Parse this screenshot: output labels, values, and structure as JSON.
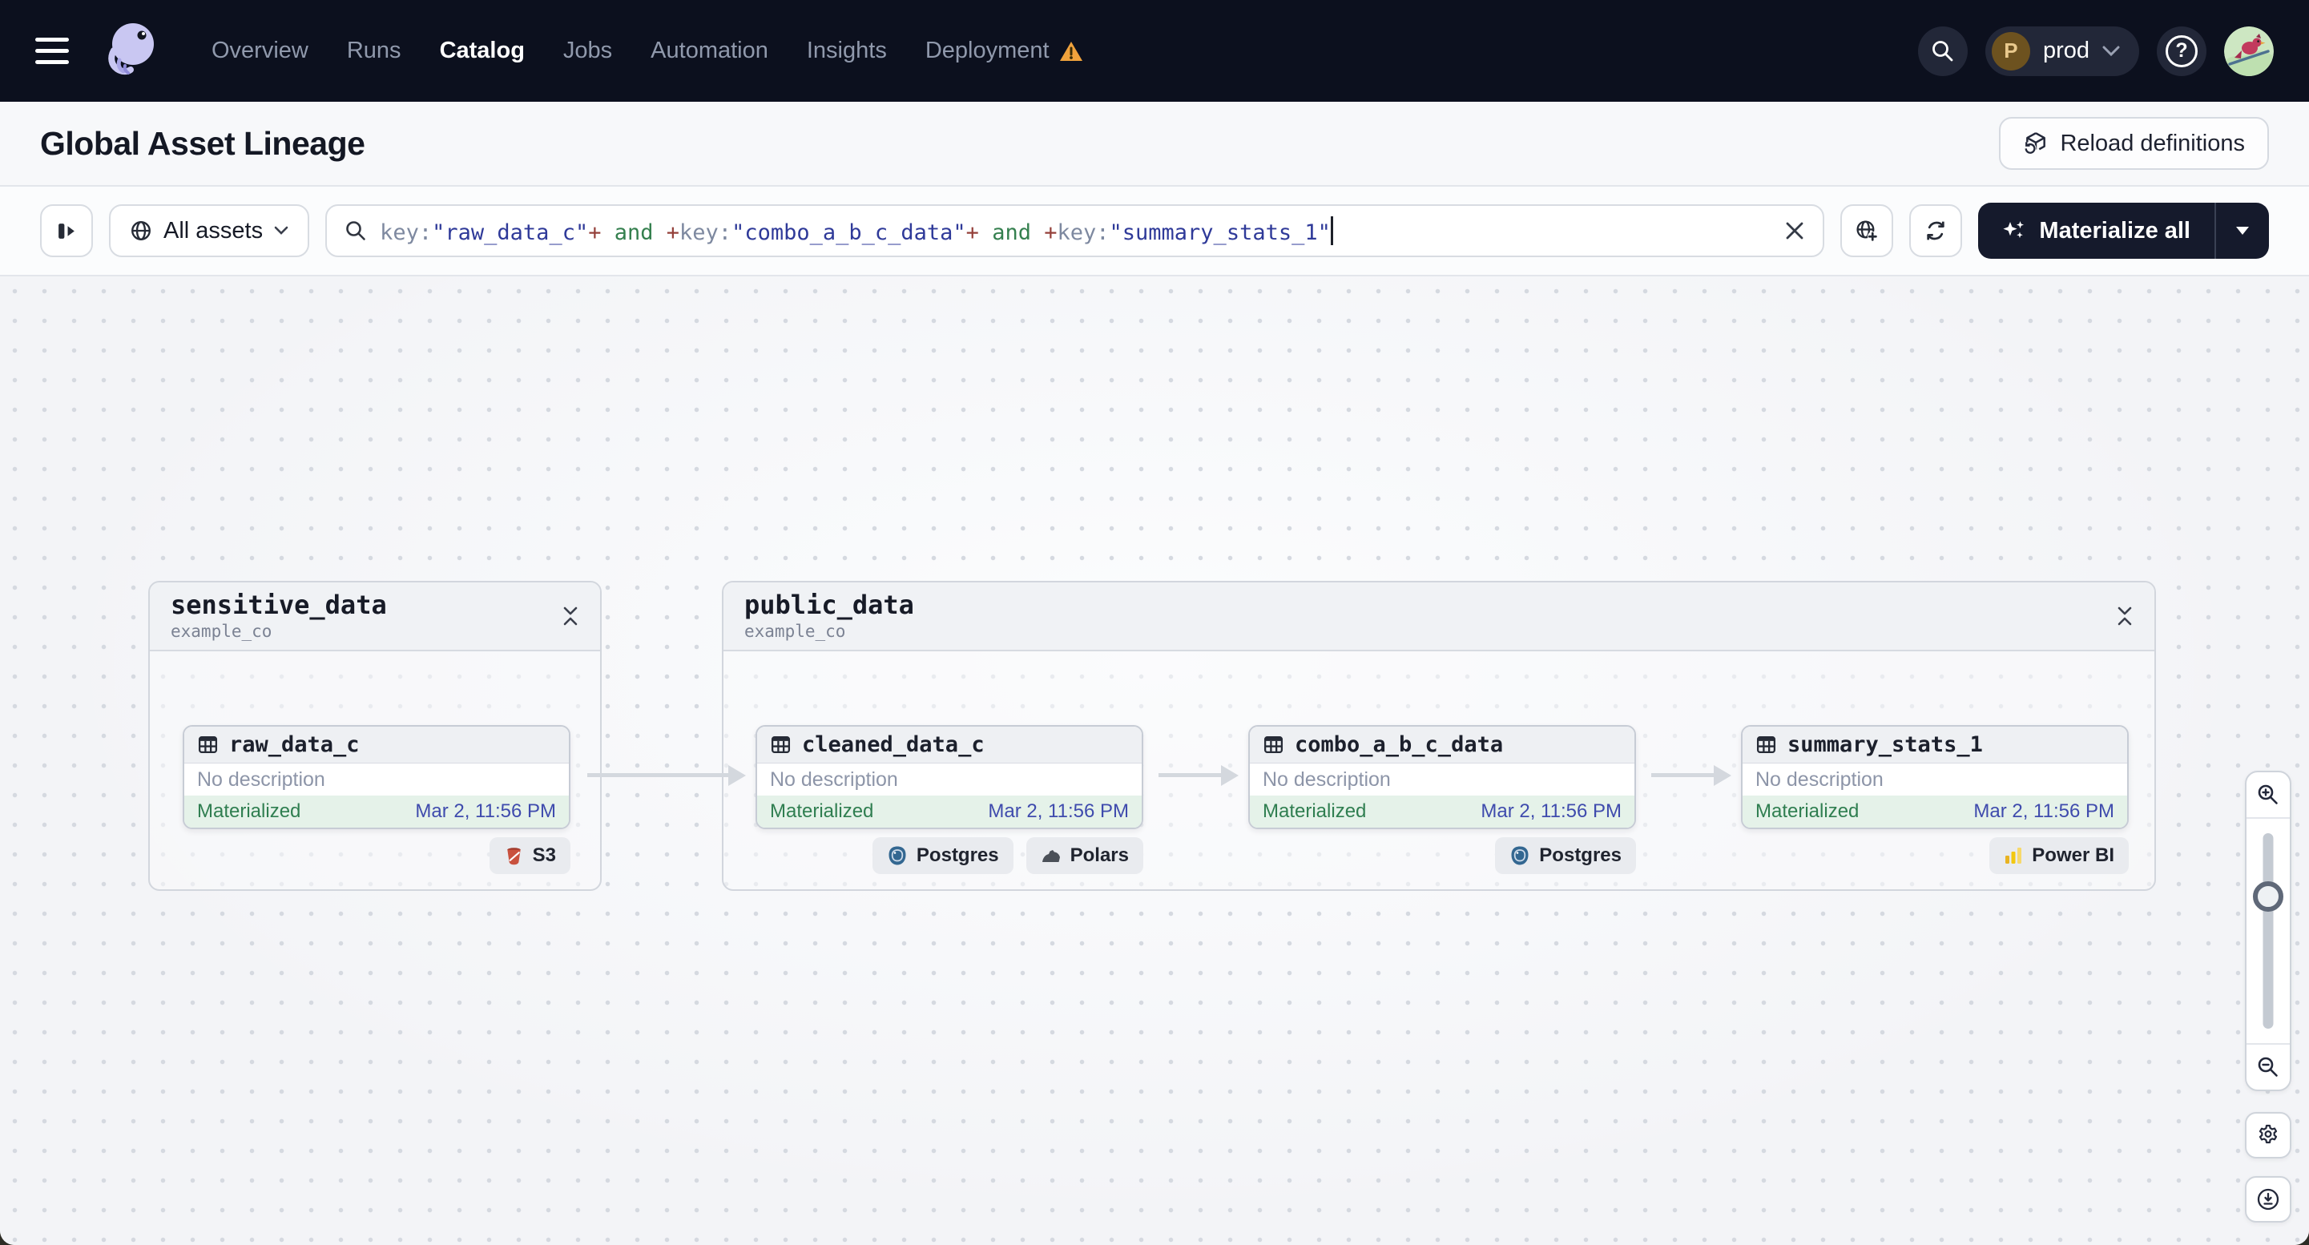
{
  "nav": {
    "items": [
      {
        "label": "Overview",
        "active": false
      },
      {
        "label": "Runs",
        "active": false
      },
      {
        "label": "Catalog",
        "active": true
      },
      {
        "label": "Jobs",
        "active": false
      },
      {
        "label": "Automation",
        "active": false
      },
      {
        "label": "Insights",
        "active": false
      },
      {
        "label": "Deployment",
        "active": false,
        "warning": true
      }
    ],
    "environment": {
      "initial": "P",
      "name": "prod"
    }
  },
  "header": {
    "title": "Global Asset Lineage",
    "reload_label": "Reload definitions"
  },
  "toolbar": {
    "scope_label": "All assets",
    "materialize_label": "Materialize all",
    "query": {
      "segments": [
        {
          "text": "key:",
          "type": "key"
        },
        {
          "text": "\"raw_data_c\"",
          "type": "string"
        },
        {
          "text": "+",
          "type": "plus"
        },
        {
          "text": " and ",
          "type": "and"
        },
        {
          "text": "+",
          "type": "plus"
        },
        {
          "text": "key:",
          "type": "key"
        },
        {
          "text": "\"combo_a_b_c_data\"",
          "type": "string"
        },
        {
          "text": "+",
          "type": "plus"
        },
        {
          "text": " and ",
          "type": "and"
        },
        {
          "text": "+",
          "type": "plus"
        },
        {
          "text": "key:",
          "type": "key"
        },
        {
          "text": "\"summary_stats_1\"",
          "type": "string"
        }
      ]
    }
  },
  "graph": {
    "groups": [
      {
        "name": "sensitive_data",
        "repo": "example_co"
      },
      {
        "name": "public_data",
        "repo": "example_co"
      }
    ],
    "nodes": [
      {
        "name": "raw_data_c",
        "description": "No description",
        "status": "Materialized",
        "timestamp": "Mar 2, 11:56 PM",
        "badges": [
          {
            "label": "S3",
            "icon": "s3-icon"
          }
        ]
      },
      {
        "name": "cleaned_data_c",
        "description": "No description",
        "status": "Materialized",
        "timestamp": "Mar 2, 11:56 PM",
        "badges": [
          {
            "label": "Postgres",
            "icon": "postgres-icon"
          },
          {
            "label": "Polars",
            "icon": "polars-icon"
          }
        ]
      },
      {
        "name": "combo_a_b_c_data",
        "description": "No description",
        "status": "Materialized",
        "timestamp": "Mar 2, 11:56 PM",
        "badges": [
          {
            "label": "Postgres",
            "icon": "postgres-icon"
          }
        ]
      },
      {
        "name": "summary_stats_1",
        "description": "No description",
        "status": "Materialized",
        "timestamp": "Mar 2, 11:56 PM",
        "badges": [
          {
            "label": "Power BI",
            "icon": "powerbi-icon"
          }
        ]
      }
    ]
  },
  "icons": {
    "help_glyph": "?"
  },
  "colors": {
    "nav_bg": "#0c101e",
    "accent_dark": "#151a2c",
    "materialized_green": "#2f7e50",
    "materialized_bg": "#e5f2e9",
    "timestamp_indigo": "#3f4bad",
    "warning_orange": "#f0a23c",
    "query_key": "#7e89a0",
    "query_string": "#2f3a99",
    "query_operator": "#94403a",
    "query_keyword": "#35804f",
    "canvas_bg": "#f3f4f7",
    "logo_lavender": "#c9c7f2"
  }
}
